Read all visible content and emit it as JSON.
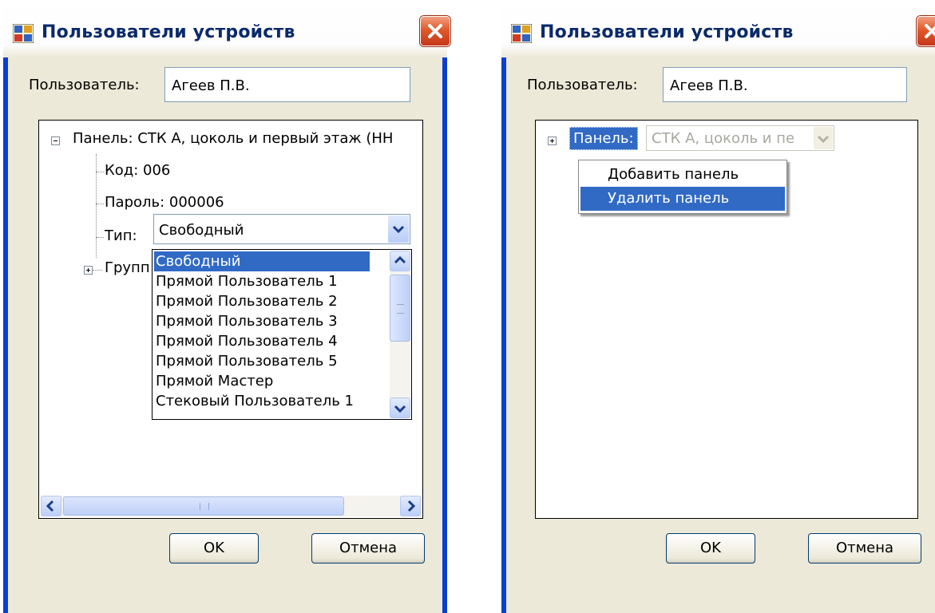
{
  "left_dialog": {
    "title": "Пользователи устройств",
    "user_label": "Пользователь:",
    "user_value": "Агеев П.В.",
    "tree": {
      "panel_node": "Панель: СТК А, цоколь и первый этаж (НН",
      "code_node": "Код: 006",
      "password_node": "Пароль: 000006",
      "type_label": "Тип:",
      "type_value": "Свободный",
      "group_node": "Групп"
    },
    "type_options": [
      "Свободный",
      "Прямой Пользователь 1",
      "Прямой Пользователь 2",
      "Прямой Пользователь 3",
      "Прямой Пользователь 4",
      "Прямой Пользователь 5",
      "Прямой Мастер",
      "Стековый Пользователь 1"
    ],
    "ok_label": "OK",
    "cancel_label": "Отмена"
  },
  "right_dialog": {
    "title": "Пользователи устройств",
    "user_label": "Пользователь:",
    "user_value": "Агеев П.В.",
    "panel_label": "Панель:",
    "panel_value": "СТК А, цоколь и пе",
    "context_menu": [
      "Добавить панель",
      "Удалить панель"
    ],
    "ok_label": "OK",
    "cancel_label": "Отмена"
  },
  "colors": {
    "title_text": "#0a2a6a",
    "border": "#0a3fd0",
    "selection": "#316ac5",
    "close_button": "#e05a2c"
  }
}
